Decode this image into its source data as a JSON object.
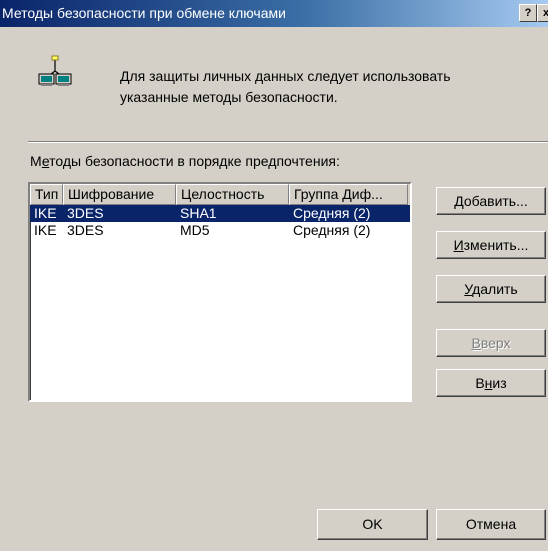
{
  "window": {
    "title": "Методы безопасности при обмене ключами",
    "help_glyph": "?",
    "close_glyph": "x"
  },
  "info": {
    "icon": "network-computers-icon",
    "line1": "Для защиты личных данных следует использовать",
    "line2": "указанные методы безопасности."
  },
  "list": {
    "label_accel": "е",
    "label_pre": "М",
    "label_post": "тоды безопасности в порядке предпочтения:",
    "columns": [
      "Тип",
      "Шифрование",
      "Целостность",
      "Группа Диф..."
    ],
    "rows": [
      {
        "type": "IKE",
        "encryption": "3DES",
        "integrity": "SHA1",
        "group": "Средняя (2)",
        "selected": true
      },
      {
        "type": "IKE",
        "encryption": "3DES",
        "integrity": "MD5",
        "group": "Средняя (2)",
        "selected": false
      }
    ]
  },
  "buttons": {
    "add": {
      "accel": "Д",
      "rest": "обавить..."
    },
    "edit": {
      "accel": "И",
      "rest": "зменить..."
    },
    "delete": {
      "accel": "У",
      "rest": "далить"
    },
    "up": {
      "accel": "В",
      "rest": "верх",
      "disabled": true
    },
    "down": {
      "pre": "В",
      "accel": "н",
      "rest": "из"
    },
    "ok": "OK",
    "cancel": "Отмена"
  },
  "colors": {
    "dialog_bg": "#d4d0c8",
    "titlebar_start": "#0a246a",
    "titlebar_end": "#a6caf0",
    "selection_bg": "#0a246a"
  }
}
